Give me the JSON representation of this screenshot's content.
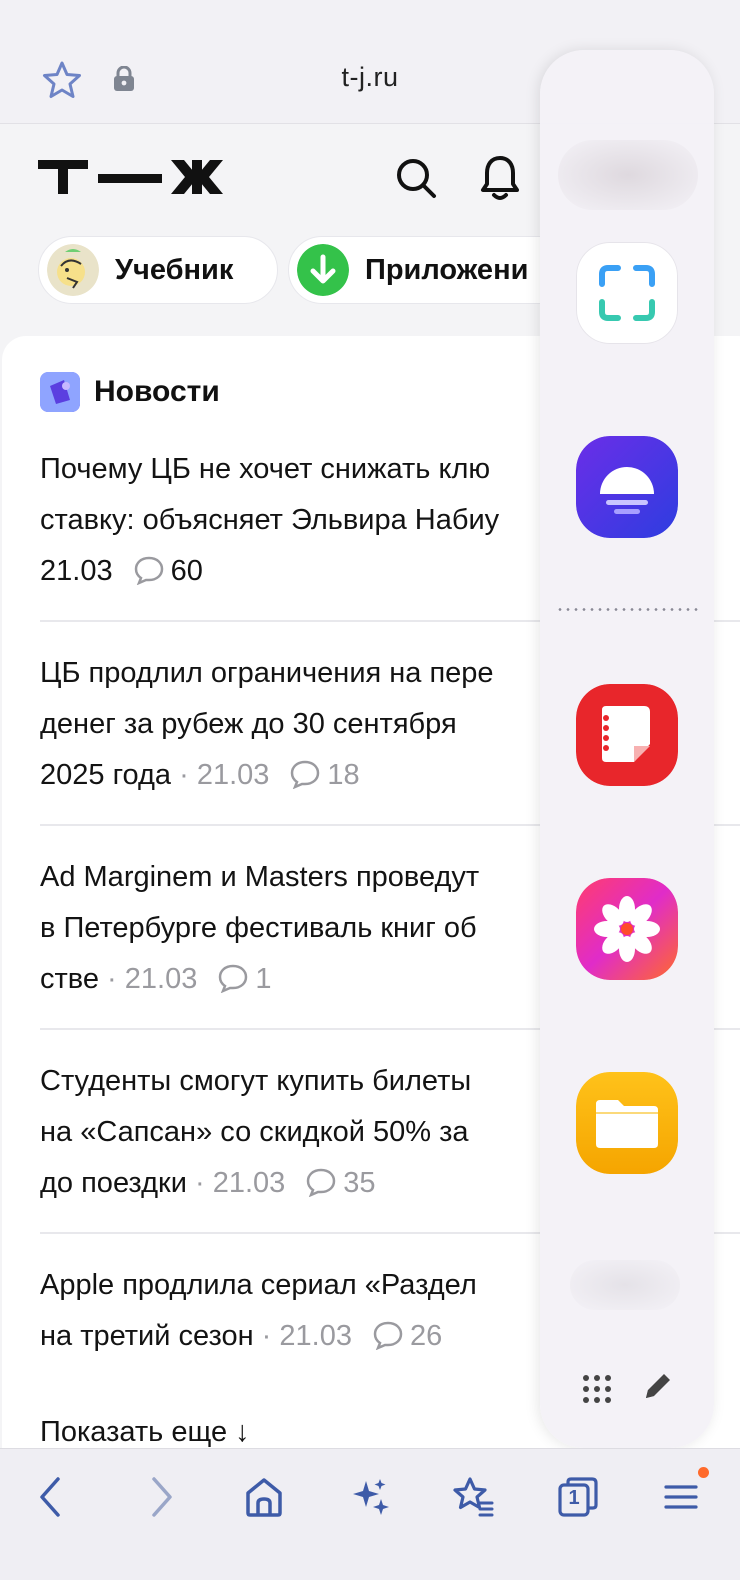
{
  "browser": {
    "url": "t-j.ru"
  },
  "site": {
    "logo_text": "Т—Ж",
    "chips": [
      {
        "label": "Учебник"
      },
      {
        "label": "Приложени"
      }
    ],
    "news_section_title": "Новости",
    "news": [
      {
        "line1": "Почему ЦБ не хочет снижать клю",
        "line2": "ставку: объясняет Эльвира Набиу",
        "date": "21.03",
        "comments": "60"
      },
      {
        "line1": "ЦБ продлил ограничения на пере",
        "line2": "денег за рубеж до 30 сентября",
        "line3": "2025 года",
        "date": "21.03",
        "comments": "18"
      },
      {
        "line1": "Ad Marginem и Masters проведут",
        "line2": "в Петербурге фестиваль книг об",
        "line3": "стве",
        "date": "21.03",
        "comments": "1"
      },
      {
        "line1": "Студенты смогут купить билеты",
        "line2": "на «Сапсан» со скидкой 50% за",
        "line3": "до поездки",
        "date": "21.03",
        "comments": "35"
      },
      {
        "line1": "Apple продлила сериал «Раздел",
        "line2": "на третий сезон",
        "date": "21.03",
        "comments": "26"
      }
    ],
    "show_more": "Показать еще ↓"
  },
  "edge_panel": {
    "apps": [
      "screenshot-app-icon",
      "bixby-app-icon",
      "notes-app-icon",
      "gallery-app-icon",
      "files-app-icon"
    ]
  },
  "toolbar": {
    "tabs_count": "1",
    "menu_badge_color": "#ff6a2b"
  }
}
